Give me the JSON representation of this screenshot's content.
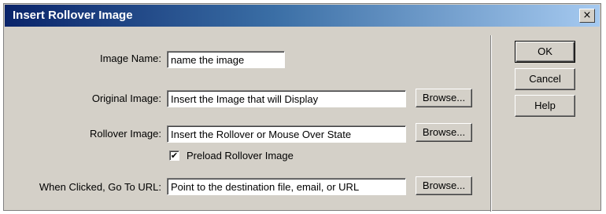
{
  "window": {
    "title": "Insert Rollover Image",
    "close_glyph": "×"
  },
  "form": {
    "image_name": {
      "label": "Image Name:",
      "value": "name the image"
    },
    "original_image": {
      "label": "Original Image:",
      "value": "Insert the Image that will Display",
      "browse_label": "Browse..."
    },
    "rollover_image": {
      "label": "Rollover Image:",
      "value": "Insert the Rollover or Mouse Over State",
      "browse_label": "Browse..."
    },
    "preload": {
      "label": "Preload Rollover Image",
      "checked": true,
      "check_glyph": "✔"
    },
    "when_clicked": {
      "label": "When Clicked, Go To URL:",
      "value": "Point to the destination file, email, or URL",
      "browse_label": "Browse..."
    }
  },
  "buttons": {
    "ok": "OK",
    "cancel": "Cancel",
    "help": "Help"
  }
}
